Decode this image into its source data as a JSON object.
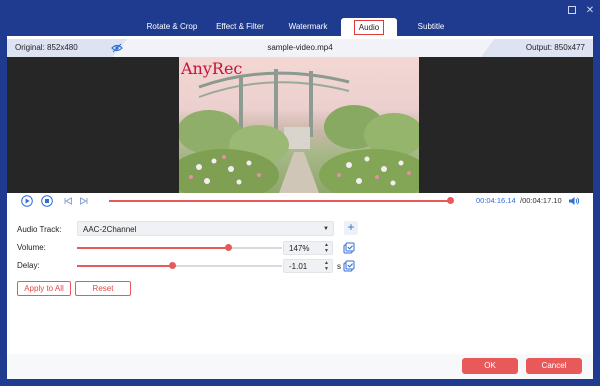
{
  "tabs": [
    {
      "label": "Rotate & Crop",
      "active": false
    },
    {
      "label": "Effect & Filter",
      "active": false
    },
    {
      "label": "Watermark",
      "active": false
    },
    {
      "label": "Audio",
      "active": true
    },
    {
      "label": "Subtitle",
      "active": false
    }
  ],
  "info": {
    "original": "Original: 852x480",
    "filename": "sample-video.mp4",
    "output": "Output: 850x477"
  },
  "preview": {
    "watermark_text": "AnyRec"
  },
  "playback": {
    "current_time": "00:04:16.14",
    "total_time": "/00:04:17.10",
    "progress": 0.99
  },
  "audio": {
    "track_label": "Audio Track:",
    "track_value": "AAC-2Channel",
    "volume_label": "Volume:",
    "volume_value": "147%",
    "volume_level": 0.735,
    "delay_label": "Delay:",
    "delay_value": "-1.01",
    "delay_unit": "s",
    "delay_level": 0.465
  },
  "buttons": {
    "apply_to_all": "Apply to All",
    "reset": "Reset",
    "ok": "OK",
    "cancel": "Cancel"
  },
  "colors": {
    "accent": "#e85a5a",
    "window_bg": "#1f3b8f",
    "time_highlight": "#2f6fd6"
  }
}
